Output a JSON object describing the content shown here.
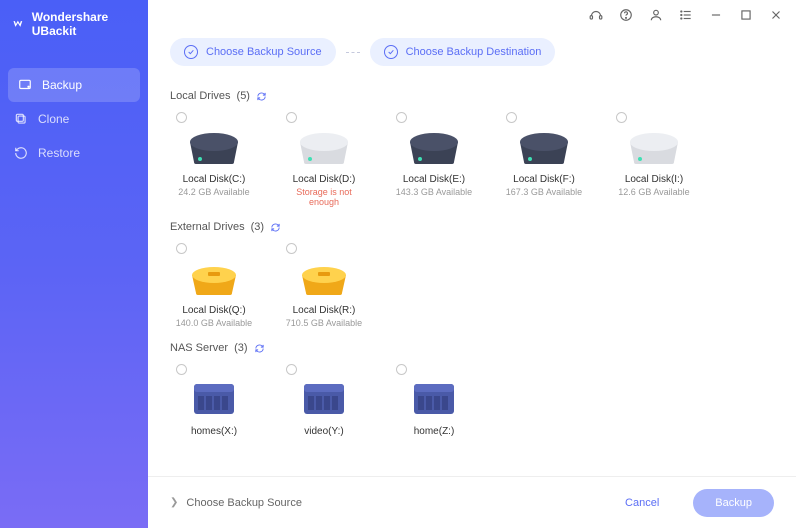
{
  "app": {
    "title": "Wondershare UBackit"
  },
  "nav": {
    "items": [
      {
        "label": "Backup",
        "active": true
      },
      {
        "label": "Clone",
        "active": false
      },
      {
        "label": "Restore",
        "active": false
      }
    ]
  },
  "steps": {
    "source": "Choose Backup Source",
    "destination": "Choose Backup Destination"
  },
  "sections": {
    "local": {
      "title": "Local Drives",
      "count": "(5)"
    },
    "external": {
      "title": "External Drives",
      "count": "(3)"
    },
    "nas": {
      "title": "NAS Server",
      "count": "(3)"
    }
  },
  "local_drives": [
    {
      "name": "Local Disk(C:)",
      "sub": "24.2 GB Available",
      "warn": false,
      "kind": "dark"
    },
    {
      "name": "Local Disk(D:)",
      "sub": "Storage is not enough",
      "warn": true,
      "kind": "light"
    },
    {
      "name": "Local Disk(E:)",
      "sub": "143.3 GB Available",
      "warn": false,
      "kind": "dark"
    },
    {
      "name": "Local Disk(F:)",
      "sub": "167.3 GB Available",
      "warn": false,
      "kind": "dark"
    },
    {
      "name": "Local Disk(I:)",
      "sub": "12.6 GB Available",
      "warn": false,
      "kind": "light"
    }
  ],
  "external_drives": [
    {
      "name": "Local Disk(Q:)",
      "sub": "140.0 GB Available"
    },
    {
      "name": "Local Disk(R:)",
      "sub": "710.5 GB Available"
    }
  ],
  "nas_drives": [
    {
      "name": "homes(X:)"
    },
    {
      "name": "video(Y:)"
    },
    {
      "name": "home(Z:)"
    }
  ],
  "footer": {
    "hint": "Choose Backup Source",
    "cancel": "Cancel",
    "backup": "Backup"
  }
}
